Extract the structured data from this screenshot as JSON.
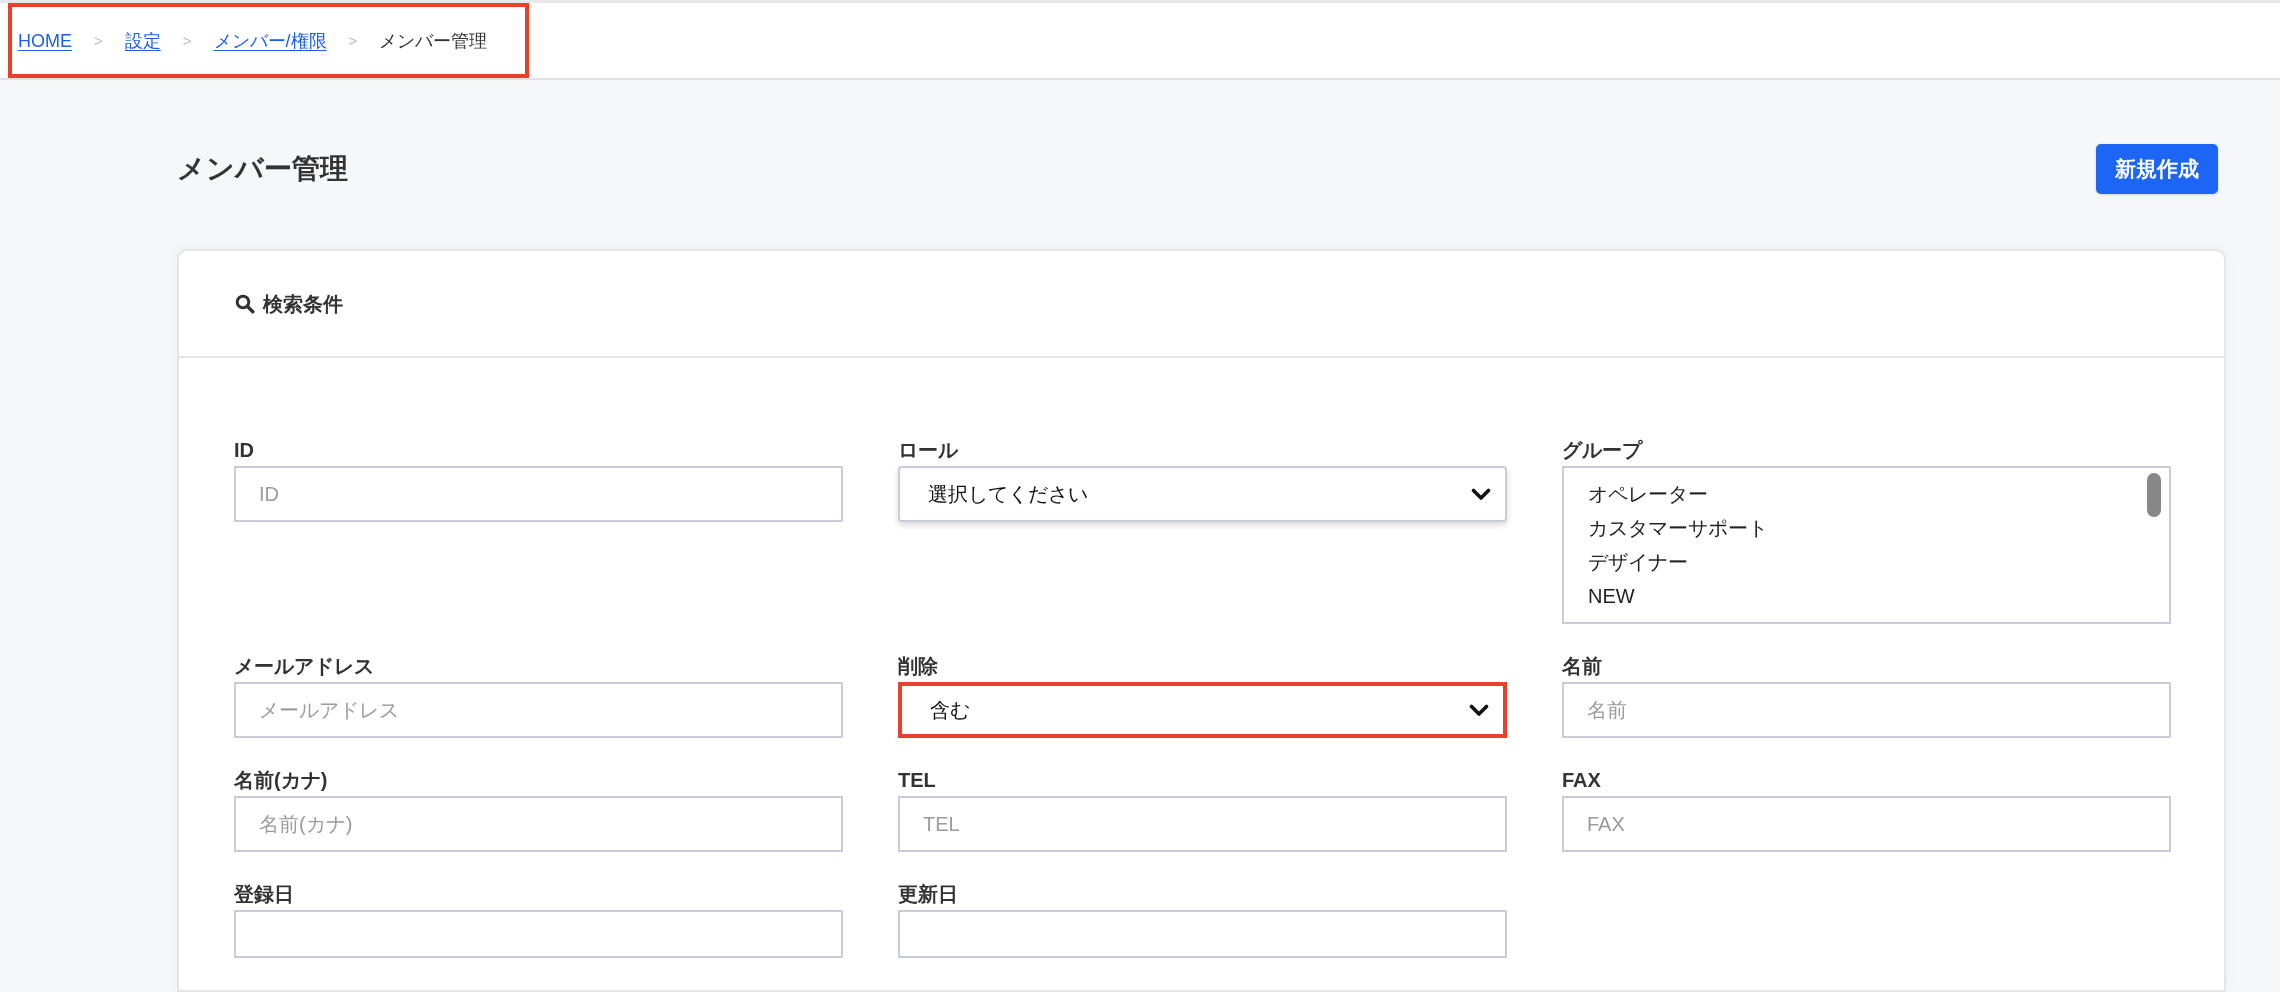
{
  "breadcrumb": {
    "highlighted": true,
    "items": [
      {
        "kind": "link",
        "label": "HOME"
      },
      {
        "kind": "separator",
        "label": ">"
      },
      {
        "kind": "link",
        "label": "設定"
      },
      {
        "kind": "separator",
        "label": ">"
      },
      {
        "kind": "link",
        "label": "メンバー/権限"
      },
      {
        "kind": "separator",
        "label": ">"
      },
      {
        "kind": "current",
        "label": "メンバー管理"
      }
    ]
  },
  "page_title": "メンバー管理",
  "new_button": {
    "label": "新規作成"
  },
  "search_panel": {
    "title": "検索条件",
    "fields": [
      {
        "kind": "text",
        "label": "ID",
        "placeholder": "ID",
        "highlighted": false
      },
      {
        "kind": "select",
        "label": "ロール",
        "value": "選択してください",
        "highlighted": false
      },
      {
        "kind": "listbox",
        "label": "グループ",
        "options": [
          "オペレーター",
          "カスタマーサポート",
          "デザイナー",
          "NEW"
        ],
        "highlighted": false
      },
      {
        "kind": "text",
        "label": "メールアドレス",
        "placeholder": "メールアドレス",
        "highlighted": false
      },
      {
        "kind": "select",
        "label": "削除",
        "value": "含む",
        "highlighted": true
      },
      {
        "kind": "text",
        "label": "名前",
        "placeholder": "名前",
        "highlighted": false
      },
      {
        "kind": "text",
        "label": "名前(カナ)",
        "placeholder": "名前(カナ)",
        "highlighted": false
      },
      {
        "kind": "text",
        "label": "TEL",
        "placeholder": "TEL",
        "highlighted": false
      },
      {
        "kind": "text",
        "label": "FAX",
        "placeholder": "FAX",
        "highlighted": false
      },
      {
        "kind": "date",
        "label": "登録日",
        "highlighted": false
      },
      {
        "kind": "date",
        "label": "更新日",
        "highlighted": false
      }
    ]
  }
}
